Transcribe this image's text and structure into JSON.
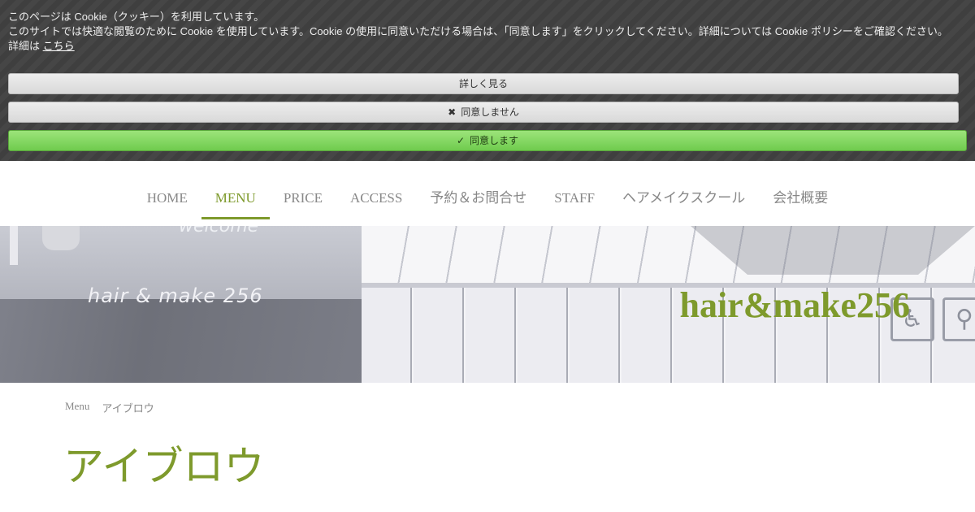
{
  "cookie_banner": {
    "line1": "このページは Cookie（クッキー）を利用しています。",
    "line2": "このサイトでは快適な閲覧のために Cookie を使用しています。Cookie の使用に同意いただける場合は、「同意します」をクリックしてください。詳細については Cookie ポリシーをご確認ください。",
    "line3_prefix": "詳細は",
    "line3_link": "こちら",
    "more_button": "詳しく見る",
    "decline_button": "同意しません",
    "accept_button": "同意します",
    "decline_icon": "close-icon",
    "accept_icon": "check-icon"
  },
  "nav": {
    "items": [
      {
        "label": "HOME"
      },
      {
        "label": "MENU"
      },
      {
        "label": "PRICE"
      },
      {
        "label": "ACCESS"
      },
      {
        "label": "予約＆お問合せ"
      },
      {
        "label": "STAFF"
      },
      {
        "label": "ヘアメイクスクール"
      },
      {
        "label": "会社概要"
      }
    ],
    "active": "MENU"
  },
  "hero": {
    "title": "hair&make256",
    "floor_text": "hair & make 256",
    "welcome_text": "welcome"
  },
  "breadcrumb": {
    "parent": "Menu",
    "current": "アイブロウ"
  },
  "page": {
    "title": "アイブロウ"
  },
  "colors": {
    "accent": "#7e9a2c",
    "banner_bg": "#3f3f3f",
    "accept_green": "#7ed65c"
  }
}
